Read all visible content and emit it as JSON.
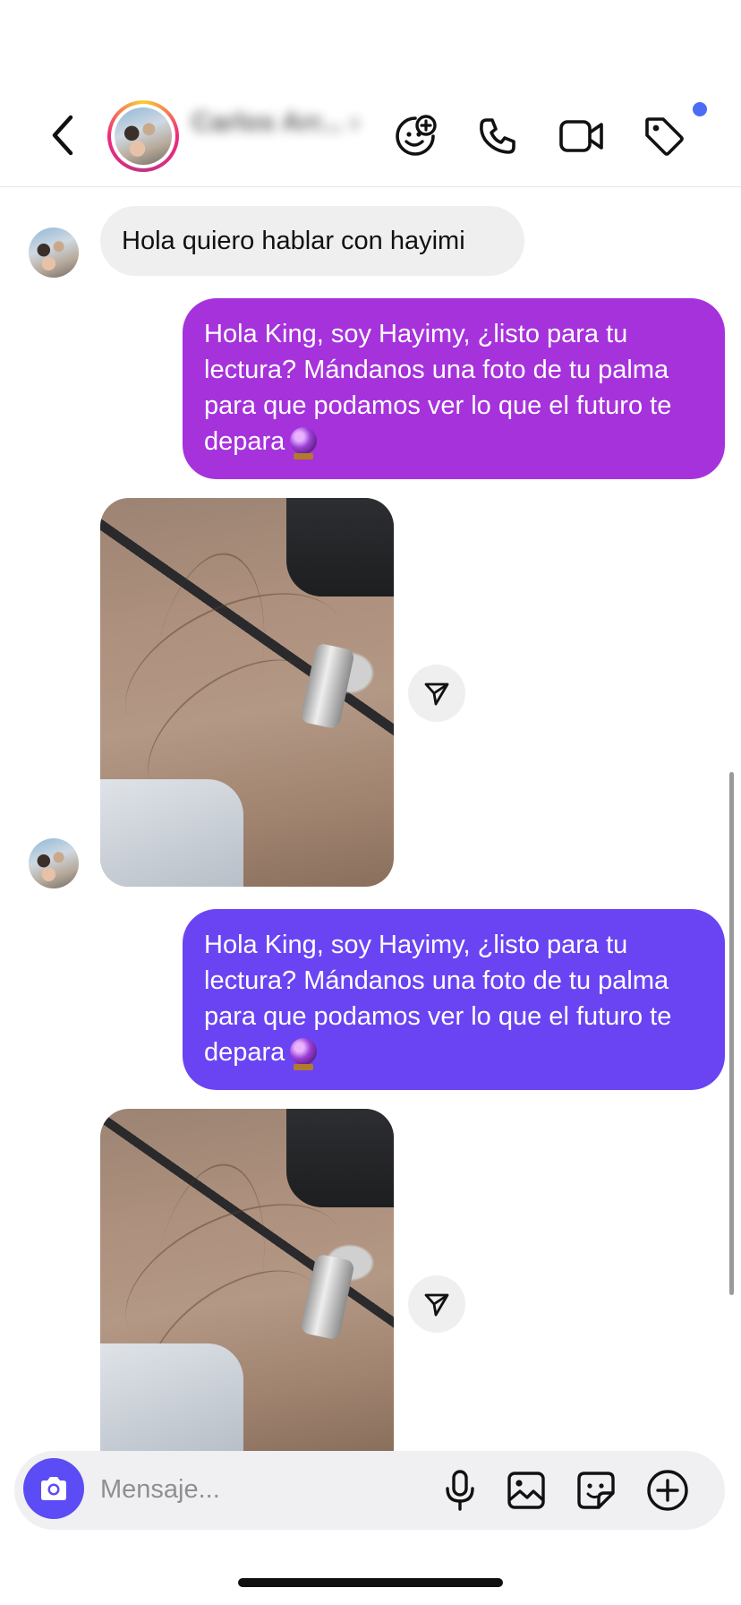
{
  "header": {
    "contact_name": "Carlos Arr... ›",
    "icons": {
      "back": "chevron-left-icon",
      "add_effect": "sticker-add-icon",
      "call": "phone-icon",
      "video": "video-camera-icon",
      "tag": "tag-icon"
    },
    "notification_dot_color": "#4a6cf7"
  },
  "messages": [
    {
      "type": "text",
      "direction": "incoming",
      "text": "Hola quiero hablar con hayimi"
    },
    {
      "type": "text",
      "direction": "outgoing",
      "text": "Hola King, soy Hayimy, ¿listo para tu lectura? Mándanos una foto de tu palma para que podamos ver lo que el futuro te depara",
      "emoji": "crystal-ball",
      "color": "#a632dc"
    },
    {
      "type": "image",
      "direction": "incoming",
      "alt": "palm-photo"
    },
    {
      "type": "text",
      "direction": "outgoing",
      "text": "Hola King, soy Hayimy, ¿listo para tu lectura? Mándanos una foto de tu palma para que podamos ver lo que el futuro te depara",
      "emoji": "crystal-ball",
      "color": "#6a44f3"
    },
    {
      "type": "image",
      "direction": "incoming",
      "alt": "palm-photo"
    }
  ],
  "composer": {
    "placeholder": "Mensaje...",
    "value": "",
    "icons": [
      "camera-icon",
      "microphone-icon",
      "gallery-icon",
      "sticker-icon",
      "plus-circle-icon"
    ],
    "camera_color": "#5b4cf5"
  }
}
